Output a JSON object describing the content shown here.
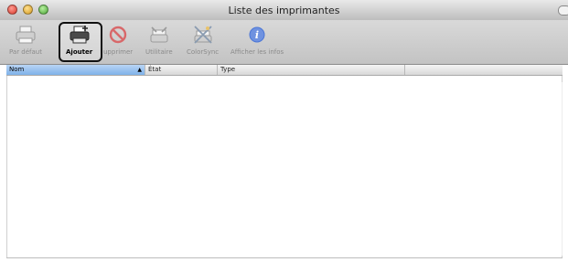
{
  "window": {
    "title": "Liste des imprimantes"
  },
  "toolbar": {
    "buttons": [
      {
        "label": "Par défaut",
        "icon": "default-printer-icon"
      },
      {
        "label": "Ajouter",
        "icon": "add-printer-icon"
      },
      {
        "label": "upprimer",
        "icon": "delete-icon"
      },
      {
        "label": "Utilitaire",
        "icon": "utility-icon"
      },
      {
        "label": "ColorSync",
        "icon": "colorsync-icon"
      },
      {
        "label": "Afficher les infos",
        "icon": "info-icon"
      }
    ]
  },
  "table": {
    "columns": [
      "Nom",
      "État",
      "Type"
    ],
    "rows": []
  },
  "colors": {
    "accent": "#7fb2ea",
    "delete": "#d8686a",
    "info": "#4b76d6"
  }
}
